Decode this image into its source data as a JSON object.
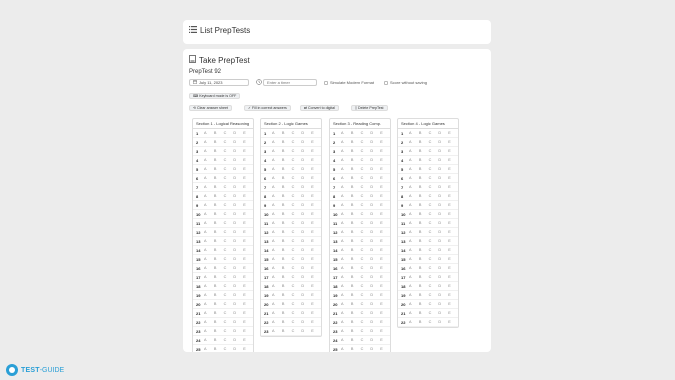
{
  "list_card": {
    "icon": "list-icon",
    "title": "List PrepTests"
  },
  "take_card": {
    "icon": "document-icon",
    "title": "Take PrepTest",
    "test_name": "PrepTest 92",
    "date_value": "July 11, 2023",
    "timer_placeholder": "Enter a timer",
    "simulate_label": "Simulate Modern Format",
    "score_label": "Score without saving",
    "keyboard_button": "Keyboard mode is OFF",
    "clear_button": "Clear answer sheet",
    "fill_button": "Fill in correct answers",
    "digital_button": "Convert to digital",
    "delete_button": "Delete PrepTest"
  },
  "choices": [
    "A",
    "B",
    "C",
    "D",
    "E"
  ],
  "sections": [
    {
      "title": "Section 1 - Logical Reasoning",
      "questions": [
        "1",
        "2",
        "3",
        "4",
        "5",
        "6",
        "7",
        "8",
        "9",
        "10",
        "11",
        "12",
        "13",
        "14",
        "15",
        "16",
        "17",
        "18",
        "19",
        "20",
        "21",
        "22",
        "23",
        "24",
        "25"
      ]
    },
    {
      "title": "Section 2 - Logic Games",
      "questions": [
        "1",
        "2",
        "3",
        "4",
        "5",
        "6",
        "7",
        "8",
        "9",
        "10",
        "11",
        "12",
        "13",
        "14",
        "15",
        "16",
        "17",
        "18",
        "19",
        "20",
        "21",
        "22",
        "23"
      ]
    },
    {
      "title": "Section 3 - Reading Comp.",
      "questions": [
        "1",
        "2",
        "3",
        "4",
        "5",
        "6",
        "7",
        "8",
        "9",
        "10",
        "11",
        "12",
        "13",
        "14",
        "15",
        "16",
        "17",
        "18",
        "19",
        "20",
        "21",
        "22",
        "23",
        "24",
        "25"
      ]
    },
    {
      "title": "Section 4 - Logic Games",
      "questions": [
        "1",
        "2",
        "3",
        "4",
        "5",
        "6",
        "7",
        "8",
        "9",
        "10",
        "11",
        "12",
        "13",
        "14",
        "15",
        "16",
        "17",
        "18",
        "19",
        "20",
        "21",
        "22"
      ]
    }
  ],
  "logo": {
    "part1": "TEST",
    "part2": "-GUIDE"
  }
}
